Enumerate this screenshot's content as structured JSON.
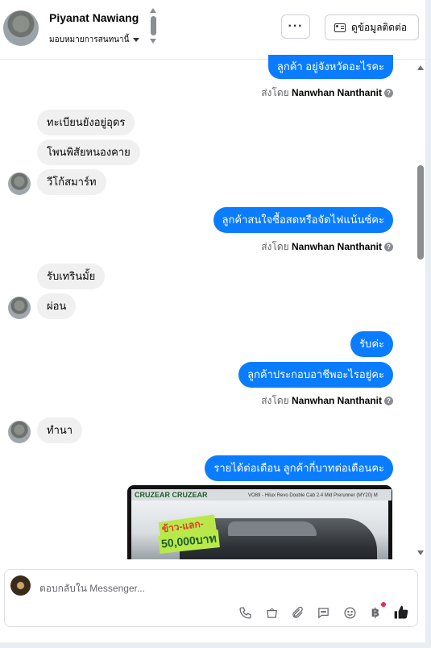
{
  "header": {
    "name": "Piyanat Nawiang",
    "assign_label": "มอบหมายการสนทนานี้",
    "more_label": "···",
    "info_button": "ดูข้อมูลติดต่อ"
  },
  "messages": [
    {
      "dir": "out",
      "text": "ลูกค้า อยู่จังหวัดอะไรคะ"
    },
    {
      "sent_by_prefix": "ส่งโดย",
      "sent_by_name": "Nanwhan Nanthanit"
    },
    {
      "dir": "in",
      "text": "ทะเบียนยังอยู่อุดร"
    },
    {
      "dir": "in",
      "text": "โพนพิสัยหนองคาย"
    },
    {
      "dir": "in",
      "text": "วีโก้สมาร์ท"
    },
    {
      "dir": "out",
      "text": "ลูกค้าสนใจซื้อสดหรือจัดไฟแน้นซ์คะ"
    },
    {
      "sent_by_prefix": "ส่งโดย",
      "sent_by_name": "Nanwhan Nanthanit"
    },
    {
      "dir": "in",
      "text": "รับเทรินมั้ย"
    },
    {
      "dir": "in",
      "text": "ผ่อน"
    },
    {
      "dir": "out",
      "text": "รับค่ะ"
    },
    {
      "dir": "out",
      "text": "ลูกค้าประกอบอาชีพอะไรอยู่คะ"
    },
    {
      "sent_by_prefix": "ส่งโดย",
      "sent_by_name": "Nanwhan Nanthanit"
    },
    {
      "dir": "in",
      "text": "ทำนา"
    },
    {
      "dir": "out",
      "text": "รายได้ต่อเดือน ลูกค้ากี่บาทต่อเดือนคะ"
    }
  ],
  "media": {
    "banner_text": "CRUZEAR CRUZEAR",
    "sub_text": "VO89 - Hilux Revo Double Cab 2.4 Mid Prerunner (MY20) M",
    "promo_line1": "ข้าว-แลก-รถ",
    "promo_line2": "50,000บาท"
  },
  "composer": {
    "placeholder": "ตอบกลับใน Messenger..."
  },
  "icons": {
    "phone": "phone-icon",
    "shop": "shopping-bag-icon",
    "attach": "paperclip-icon",
    "quick_reply": "chat-bubble-icon",
    "emoji": "emoji-icon",
    "payment": "baht-icon",
    "like": "thumbs-up-icon"
  },
  "colors": {
    "outgoing_bubble": "#0a7cff",
    "incoming_bubble": "#f0f0f0",
    "notification_dot": "#f02849"
  }
}
